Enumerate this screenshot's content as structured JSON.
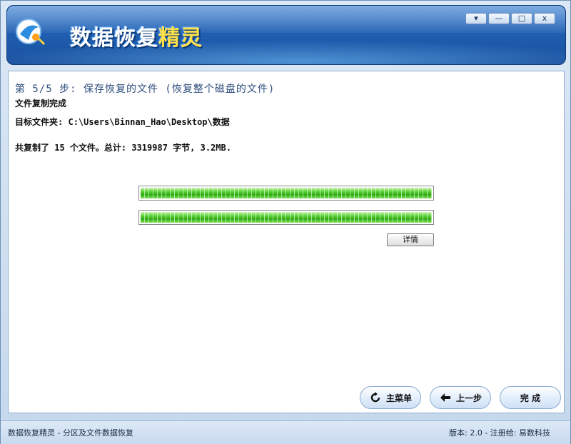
{
  "app": {
    "title_main": "数据恢复",
    "title_accent": "精灵"
  },
  "window_controls": {
    "menu_glyph": "▾",
    "minimize_glyph": "—",
    "maximize_glyph": "□",
    "close_glyph": "x"
  },
  "content": {
    "step_title": "第 5/5 步: 保存恢复的文件 (恢复整个磁盘的文件)",
    "status_line": "文件复制完成",
    "target_folder_label": "目标文件夹:",
    "target_folder_path": "C:\\Users\\Binnan_Hao\\Desktop\\数据",
    "summary": "共复制了 15 个文件。总计: 3319987 字节, 3.2MB.",
    "progress_1": 1.0,
    "progress_2": 1.0,
    "details_button": "详情"
  },
  "nav": {
    "main_menu": "主菜单",
    "previous": "上一步",
    "finish": "完 成"
  },
  "statusbar": {
    "left": "数据恢复精灵 - 分区及文件数据恢复",
    "right": "版本: 2.0 - 注册给: 易数科技"
  },
  "colors": {
    "header_blue": "#1f5fb2",
    "progress_green": "#2faa12",
    "title_text": "#2f4e7d"
  }
}
